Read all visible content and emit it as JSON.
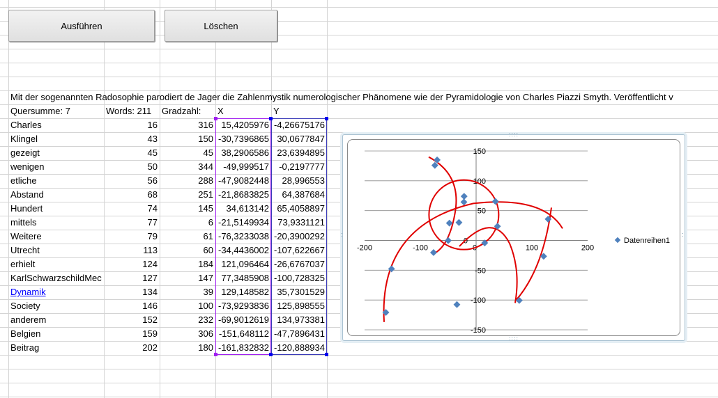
{
  "buttons": {
    "run": "Ausführen",
    "clear": "Löschen"
  },
  "intro_text": "Mit der sogenannten Radosophie parodiert de Jager die Zahlenmystik numerologischer Phänomene wie der Pyramidologie von Charles Piazzi Smyth. Veröffentlicht v",
  "header": {
    "quersumme": "Quersumme: 7",
    "words": "Words: 211",
    "gradzahl": "Gradzahl:",
    "x": "X",
    "y": "Y"
  },
  "rows": [
    {
      "word": "Charles",
      "n": "16",
      "deg": "316",
      "x": "15,4205976",
      "y": "-4,26675176"
    },
    {
      "word": "Klingel",
      "n": "43",
      "deg": "150",
      "x": "-30,7396865",
      "y": "30,0677847"
    },
    {
      "word": "gezeigt",
      "n": "45",
      "deg": "45",
      "x": "38,2906586",
      "y": "23,6394895"
    },
    {
      "word": "wenigen",
      "n": "50",
      "deg": "344",
      "x": "-49,999517",
      "y": "-0,2197777"
    },
    {
      "word": "etliche",
      "n": "56",
      "deg": "288",
      "x": "-47,9082448",
      "y": "28,996553"
    },
    {
      "word": "Abstand",
      "n": "68",
      "deg": "251",
      "x": "-21,8683825",
      "y": "64,387684"
    },
    {
      "word": "Hundert",
      "n": "74",
      "deg": "145",
      "x": "34,613142",
      "y": "65,4058897"
    },
    {
      "word": "mittels",
      "n": "77",
      "deg": "6",
      "x": "-21,5149934",
      "y": "73,9331121"
    },
    {
      "word": "Weitere",
      "n": "79",
      "deg": "61",
      "x": "-76,3233038",
      "y": "-20,3900292"
    },
    {
      "word": "Utrecht",
      "n": "113",
      "deg": "60",
      "x": "-34,4436002",
      "y": "-107,622667"
    },
    {
      "word": "erhielt",
      "n": "124",
      "deg": "184",
      "x": "121,096464",
      "y": "-26,6767037"
    },
    {
      "word": "KarlSchwarzschildMec",
      "n": "127",
      "deg": "147",
      "x": "77,3485908",
      "y": "-100,728325"
    },
    {
      "word": "Dynamik",
      "n": "134",
      "deg": "39",
      "x": "129,148582",
      "y": "35,7301529",
      "link": true
    },
    {
      "word": "Society",
      "n": "146",
      "deg": "100",
      "x": "-73,9293836",
      "y": "125,898555"
    },
    {
      "word": "anderem",
      "n": "152",
      "deg": "232",
      "x": "-69,9012619",
      "y": "134,973381"
    },
    {
      "word": "Belgien",
      "n": "159",
      "deg": "306",
      "x": "-151,648112",
      "y": "-47,7896431"
    },
    {
      "word": "Beitrag",
      "n": "202",
      "deg": "180",
      "x": "-161,832832",
      "y": "-120,888934"
    }
  ],
  "chart_data": {
    "type": "scatter",
    "series": [
      {
        "name": "Datenreihen1",
        "x": [
          15.4205976,
          -30.7396865,
          38.2906586,
          -49.999517,
          -47.9082448,
          -21.8683825,
          34.613142,
          -21.5149934,
          -76.3233038,
          -34.4436002,
          121.096464,
          77.3485908,
          129.148582,
          -73.9293836,
          -69.9012619,
          -151.648112,
          -161.832832
        ],
        "y": [
          -4.26675176,
          30.0677847,
          23.6394895,
          -0.2197777,
          28.996553,
          64.387684,
          65.4058897,
          73.9331121,
          -20.3900292,
          -107.622667,
          -26.6767037,
          -100.728325,
          35.7301529,
          125.898555,
          134.973381,
          -47.7896431,
          -120.888934
        ]
      }
    ],
    "xlim": [
      -200,
      200
    ],
    "ylim": [
      -150,
      150
    ],
    "xticks": [
      "-200",
      "-100",
      "0",
      "100",
      "200"
    ],
    "yticks": [
      "150",
      "100",
      "50",
      "0",
      "-50",
      "-100",
      "-150"
    ],
    "grid": true,
    "legend": "right",
    "marker_color": "#4f81bd",
    "annotation_color": "#e00000"
  },
  "colors": {
    "gridline": "#d4d4d4",
    "selection": "#3a3ab8",
    "handle_purple": "#a020f0",
    "handle_blue": "#0000ee"
  }
}
